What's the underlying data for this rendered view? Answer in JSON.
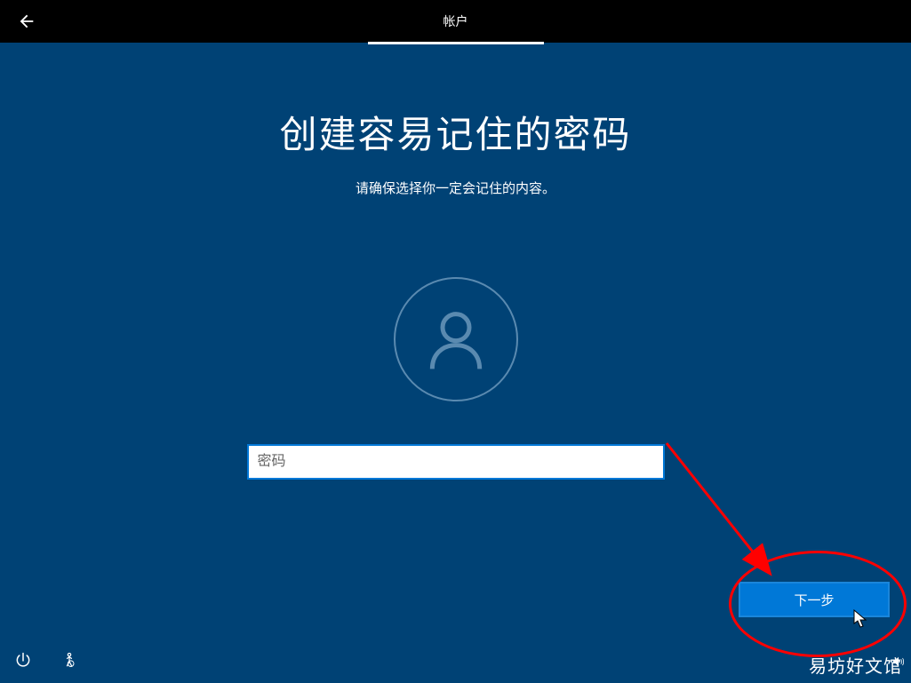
{
  "topbar": {
    "tab_label": "帐户"
  },
  "main": {
    "title": "创建容易记住的密码",
    "subtitle": "请确保选择你一定会记住的内容。"
  },
  "form": {
    "password_placeholder": "密码"
  },
  "actions": {
    "next_label": "下一步"
  },
  "watermark": "易坊好文馆"
}
